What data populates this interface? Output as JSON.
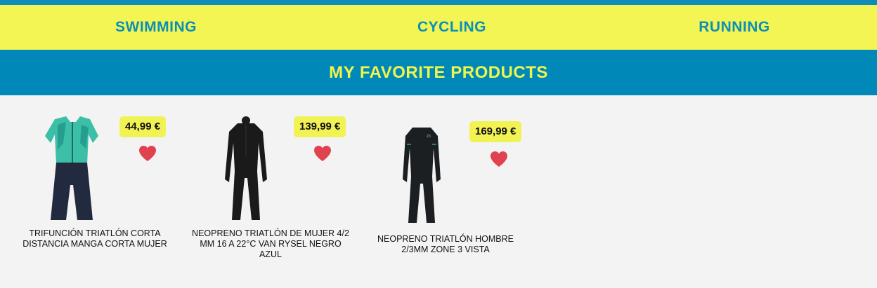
{
  "nav": {
    "items": [
      {
        "label": "SWIMMING"
      },
      {
        "label": "CYCLING"
      },
      {
        "label": "RUNNING"
      }
    ]
  },
  "banner": {
    "title": "MY FAVORITE PRODUCTS"
  },
  "products": [
    {
      "name": "TRIFUNCIÓN TRIATLÓN CORTA DISTANCIA MANGA CORTA MUJER",
      "price": "44,99 €",
      "image": "trisuit-image"
    },
    {
      "name": "NEOPRENO TRIATLÓN DE MUJER 4/2 MM 16 A 22°C VAN RYSEL NEGRO AZUL",
      "price": "139,99 €",
      "image": "womens-wetsuit-image"
    },
    {
      "name": "NEOPRENO TRIATLÓN HOMBRE 2/3MM ZONE 3 VISTA",
      "price": "169,99 €",
      "image": "mens-wetsuit-image"
    }
  ],
  "colors": {
    "accent_blue": "#0089b8",
    "accent_yellow": "#f3f555",
    "heart_red": "#e0434f"
  }
}
